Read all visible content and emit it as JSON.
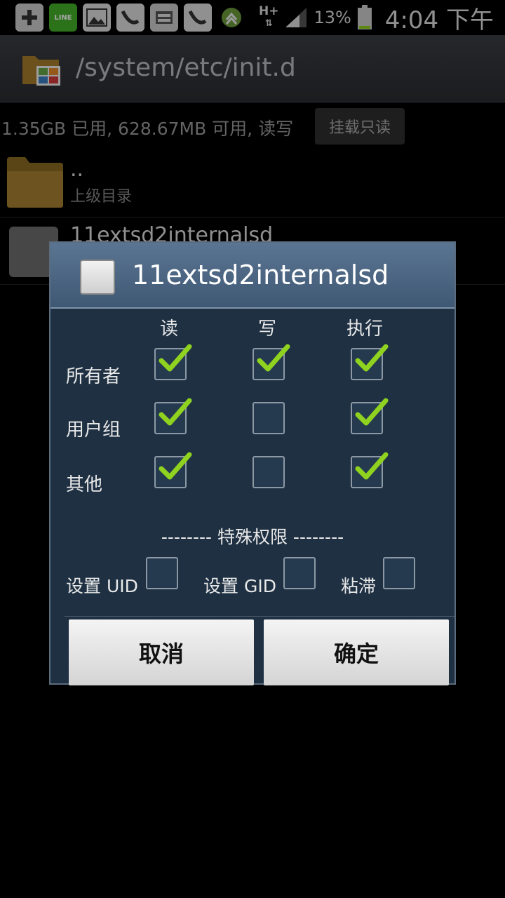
{
  "statusbar": {
    "network": "H+",
    "battery_percent": "13%",
    "battery_level": 13,
    "time": "4:04 下午",
    "line_badge": "LINE",
    "icons": [
      "add-icon",
      "line-app-icon",
      "gallery-icon",
      "app-icon",
      "app-icon",
      "app-icon",
      "game-icon"
    ]
  },
  "titlebar": {
    "path": "/system/etc/init.d"
  },
  "storage": {
    "info": "1.35GB 已用, 628.67MB 可用, 读写",
    "mount_button": "挂载只读"
  },
  "list": [
    {
      "name": "..",
      "subtitle": "上级目录"
    },
    {
      "name": "11extsd2internalsd"
    }
  ],
  "dialog": {
    "title": "11extsd2internalsd",
    "columns": [
      "读",
      "写",
      "执行"
    ],
    "rows": [
      {
        "label": "所有者",
        "read": true,
        "write": true,
        "exec": true
      },
      {
        "label": "用户组",
        "read": true,
        "write": false,
        "exec": true
      },
      {
        "label": "其他",
        "read": true,
        "write": false,
        "exec": true
      }
    ],
    "special_title": "-------- 特殊权限 --------",
    "special": [
      {
        "label": "设置 UID",
        "checked": false
      },
      {
        "label": "设置 GID",
        "checked": false
      },
      {
        "label": "粘滞",
        "checked": false
      }
    ],
    "cancel": "取消",
    "ok": "确定"
  },
  "colors": {
    "check": "#8fd21f",
    "dialog_bg": "#1e3042",
    "header": "#4b6684"
  }
}
